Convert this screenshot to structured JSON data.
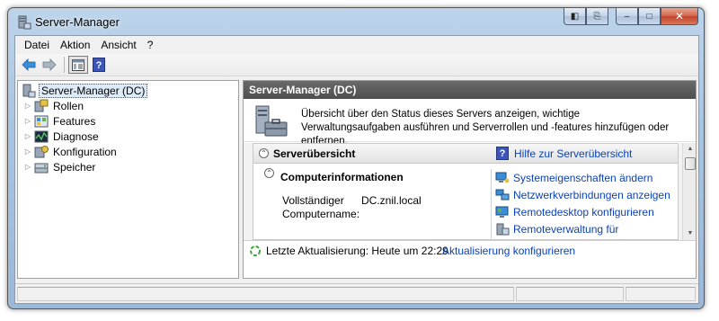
{
  "window": {
    "title": "Server-Manager",
    "caption": {
      "restore": "◧",
      "pin": "⎘",
      "minimize": "–",
      "maximize": "□",
      "close": "✕"
    }
  },
  "menu": [
    "Datei",
    "Aktion",
    "Ansicht",
    "?"
  ],
  "toolbar": {
    "back_icon": "back-arrow-icon",
    "forward_icon": "forward-arrow-icon",
    "console_tree_icon": "show-hide-tree-icon",
    "help_icon": "help-icon",
    "help_glyph": "?"
  },
  "tree": {
    "root": "Server-Manager (DC)",
    "items": [
      "Rollen",
      "Features",
      "Diagnose",
      "Konfiguration",
      "Speicher"
    ]
  },
  "content": {
    "header": "Server-Manager (DC)",
    "intro": "Übersicht über den Status dieses Servers anzeigen, wichtige Verwaltungsaufgaben ausführen und Serverrollen und -features hinzufügen oder entfernen.",
    "section": {
      "title": "Serverübersicht",
      "help_link": "Hilfe zur Serverübersicht",
      "help_glyph": "?",
      "sub_title": "Computerinformationen",
      "key": "Vollständiger Computername:",
      "value": "DC.znil.local",
      "tasks": [
        "Systemeigenschaften ändern",
        "Netzwerkverbindungen anzeigen",
        "Remotedesktop konfigurieren",
        "Remoteverwaltung für"
      ]
    },
    "refresh_text": "Letzte Aktualisierung: Heute um 22:29",
    "refresh_link": "Aktualisierung konfigurieren"
  },
  "colors": {
    "link": "#0b42b8",
    "header_bg": "#4e4e4e",
    "frame": "#a9c4e0"
  }
}
